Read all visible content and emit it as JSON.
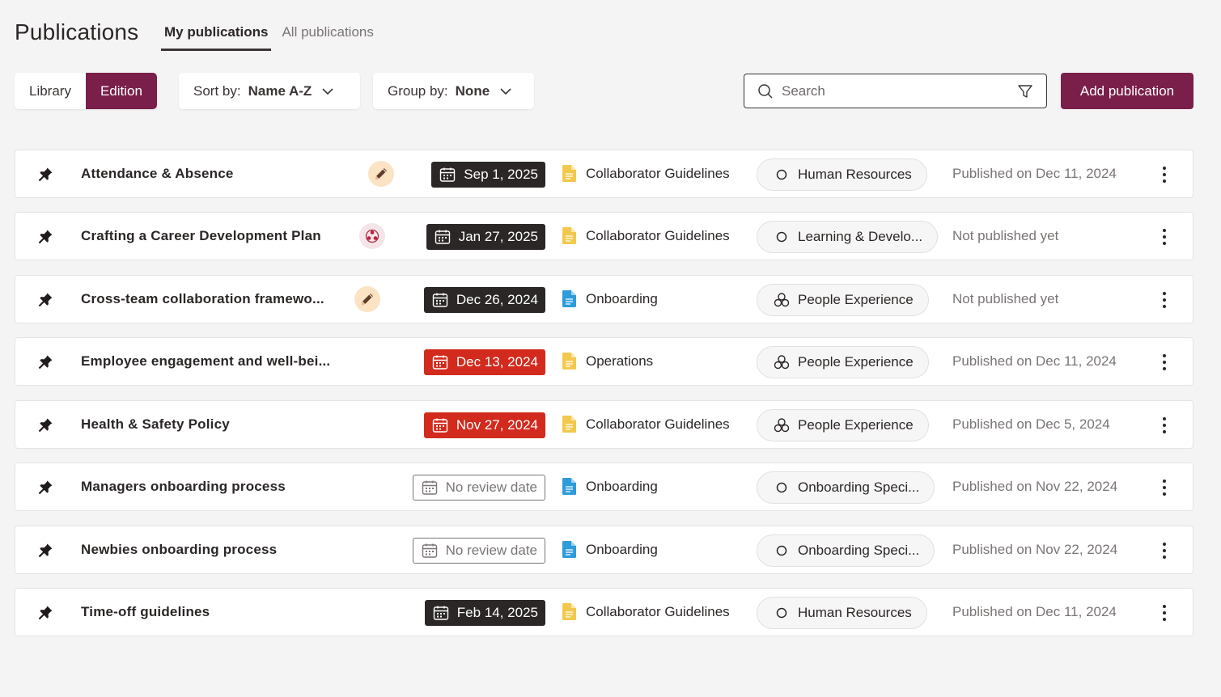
{
  "header": {
    "title": "Publications",
    "tabs": [
      {
        "label": "My publications",
        "active": true
      },
      {
        "label": "All publications",
        "active": false
      }
    ]
  },
  "toolbar": {
    "view_toggle": [
      {
        "label": "Library",
        "active": false
      },
      {
        "label": "Edition",
        "active": true
      }
    ],
    "sort": {
      "label": "Sort by:",
      "value": "Name A-Z"
    },
    "group": {
      "label": "Group by:",
      "value": "None"
    },
    "search": {
      "placeholder": "Search",
      "icon": "search-icon",
      "filter_icon": "filter-icon"
    },
    "add_button_label": "Add publication"
  },
  "colors": {
    "brand": "#7a1f4a",
    "dark_badge": "#2b2726",
    "overdue_badge": "#d22a1d",
    "doc_yellow": "#f2c94c",
    "doc_blue": "#2d9cdb"
  },
  "rows": [
    {
      "title": "Attendance & Absence",
      "status_icon": "pencil-icon",
      "date": "Sep 1, 2025",
      "date_style": "dark",
      "doc_color": "yellow",
      "collection": "Collaborator Guidelines",
      "audience": "Human Resources",
      "audience_icon": "circle-icon",
      "status": "Published on Dec 11, 2024"
    },
    {
      "title": "Crafting a Career Development Plan",
      "status_icon": "review-icon",
      "date": "Jan 27, 2025",
      "date_style": "dark",
      "doc_color": "yellow",
      "collection": "Collaborator Guidelines",
      "audience": "Learning & Develo...",
      "audience_icon": "circle-icon",
      "status": "Not published yet"
    },
    {
      "title": "Cross-team collaboration framewo...",
      "status_icon": "pencil-icon",
      "date": "Dec 26, 2024",
      "date_style": "dark",
      "doc_color": "blue",
      "collection": "Onboarding",
      "audience": "People Experience",
      "audience_icon": "people-icon",
      "status": "Not published yet"
    },
    {
      "title": "Employee engagement and well-bei...",
      "status_icon": "",
      "date": "Dec 13, 2024",
      "date_style": "red",
      "doc_color": "yellow",
      "collection": "Operations",
      "audience": "People Experience",
      "audience_icon": "people-icon",
      "status": "Published on Dec 11, 2024"
    },
    {
      "title": "Health & Safety Policy",
      "status_icon": "",
      "date": "Nov 27, 2024",
      "date_style": "red",
      "doc_color": "yellow",
      "collection": "Collaborator Guidelines",
      "audience": "People Experience",
      "audience_icon": "people-icon",
      "status": "Published on Dec 5, 2024"
    },
    {
      "title": "Managers onboarding process",
      "status_icon": "",
      "date": "No review date",
      "date_style": "none",
      "doc_color": "blue",
      "collection": "Onboarding",
      "audience": "Onboarding Speci...",
      "audience_icon": "circle-icon",
      "status": "Published on Nov 22, 2024"
    },
    {
      "title": "Newbies onboarding process",
      "status_icon": "",
      "date": "No review date",
      "date_style": "none",
      "doc_color": "blue",
      "collection": "Onboarding",
      "audience": "Onboarding Speci...",
      "audience_icon": "circle-icon",
      "status": "Published on Nov 22, 2024"
    },
    {
      "title": "Time-off guidelines",
      "status_icon": "",
      "date": "Feb 14, 2025",
      "date_style": "dark",
      "doc_color": "yellow",
      "collection": "Collaborator Guidelines",
      "audience": "Human Resources",
      "audience_icon": "circle-icon",
      "status": "Published on Dec 11, 2024"
    }
  ]
}
